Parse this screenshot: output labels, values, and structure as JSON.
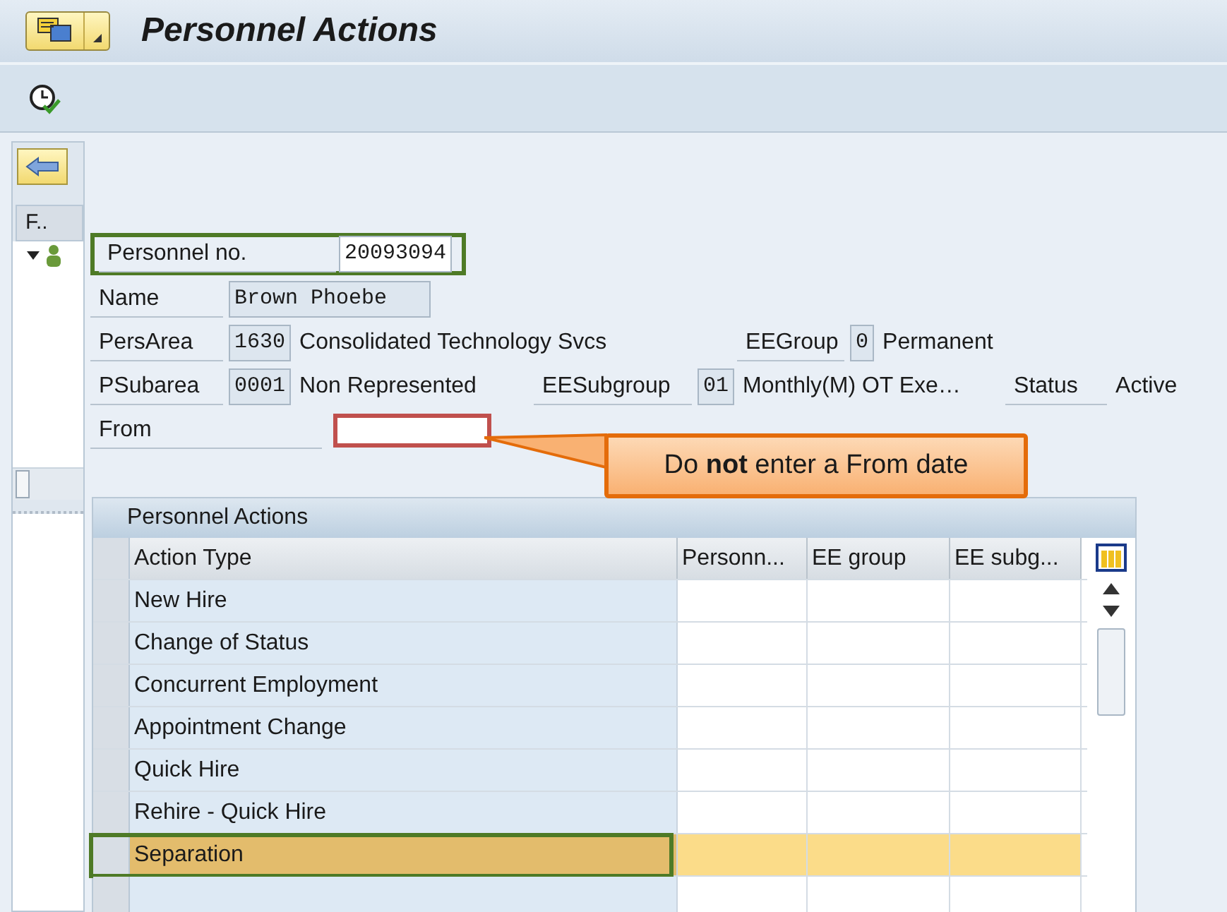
{
  "title_bar": {
    "title": "Personnel Actions"
  },
  "nav": {
    "column_header": "F.."
  },
  "form": {
    "personnel_no": {
      "label": "Personnel no.",
      "value": "20093094",
      "highlight": {
        "color": "#4e7a26"
      }
    },
    "name": {
      "label": "Name",
      "value": "Brown Phoebe"
    },
    "pers_area": {
      "label": "PersArea",
      "code": "1630",
      "text": "Consolidated Technology Svcs"
    },
    "ee_group": {
      "label": "EEGroup",
      "code": "0",
      "text": "Permanent"
    },
    "psubarea": {
      "label": "PSubarea",
      "code": "0001",
      "text": "Non Represented"
    },
    "ee_subgroup": {
      "label": "EESubgroup",
      "code": "01",
      "text": "Monthly(M) OT Exe…"
    },
    "status": {
      "label": "Status",
      "text": "Active"
    },
    "from": {
      "label": "From",
      "highlight": {
        "color": "#c0504d"
      }
    }
  },
  "callout": {
    "text": "Do **not** enter a From date"
  },
  "table": {
    "title": "Personnel Actions",
    "columns": [
      "Action Type",
      "Personn...",
      "EE group",
      "EE subg..."
    ],
    "rows": [
      {
        "action_type": "New Hire",
        "selected": false,
        "highlight": false
      },
      {
        "action_type": "Change of Status",
        "selected": false,
        "highlight": false
      },
      {
        "action_type": "Concurrent Employment",
        "selected": false,
        "highlight": false
      },
      {
        "action_type": "Appointment Change",
        "selected": false,
        "highlight": false
      },
      {
        "action_type": "Quick Hire",
        "selected": false,
        "highlight": false
      },
      {
        "action_type": "Rehire - Quick Hire",
        "selected": false,
        "highlight": false
      },
      {
        "action_type": "Separation",
        "selected": true,
        "highlight": {
          "color": "#4e7a26"
        }
      }
    ]
  }
}
